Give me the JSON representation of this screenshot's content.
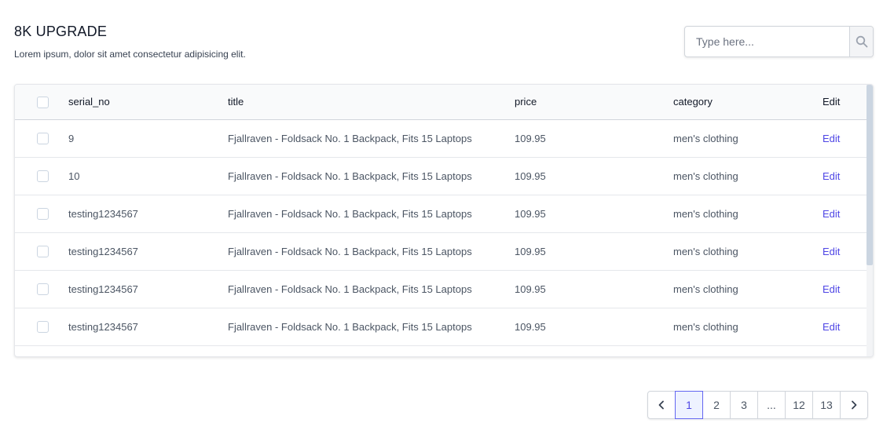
{
  "header": {
    "title": "8K UPGRADE",
    "subtitle": "Lorem ipsum, dolor sit amet consectetur adipisicing elit."
  },
  "search": {
    "placeholder": "Type here...",
    "value": "",
    "icon": "search-icon"
  },
  "table": {
    "columns": [
      "serial_no",
      "title",
      "price",
      "category",
      "Edit"
    ],
    "rows": [
      {
        "serial_no": "9",
        "title": "Fjallraven - Foldsack No. 1 Backpack, Fits 15 Laptops",
        "price": "109.95",
        "category": "men's clothing",
        "edit": "Edit"
      },
      {
        "serial_no": "10",
        "title": "Fjallraven - Foldsack No. 1 Backpack, Fits 15 Laptops",
        "price": "109.95",
        "category": "men's clothing",
        "edit": "Edit"
      },
      {
        "serial_no": "testing1234567",
        "title": "Fjallraven - Foldsack No. 1 Backpack, Fits 15 Laptops",
        "price": "109.95",
        "category": "men's clothing",
        "edit": "Edit"
      },
      {
        "serial_no": "testing1234567",
        "title": "Fjallraven - Foldsack No. 1 Backpack, Fits 15 Laptops",
        "price": "109.95",
        "category": "men's clothing",
        "edit": "Edit"
      },
      {
        "serial_no": "testing1234567",
        "title": "Fjallraven - Foldsack No. 1 Backpack, Fits 15 Laptops",
        "price": "109.95",
        "category": "men's clothing",
        "edit": "Edit"
      },
      {
        "serial_no": "testing1234567",
        "title": "Fjallraven - Foldsack No. 1 Backpack, Fits 15 Laptops",
        "price": "109.95",
        "category": "men's clothing",
        "edit": "Edit"
      }
    ]
  },
  "pagination": {
    "prev_icon": "chevron-left-icon",
    "next_icon": "chevron-right-icon",
    "pages": [
      "1",
      "2",
      "3",
      "...",
      "12",
      "13"
    ],
    "current": "1"
  },
  "colors": {
    "accent": "#4f46e5",
    "active_page_bg": "#eef2ff",
    "border": "#d1d5db"
  }
}
